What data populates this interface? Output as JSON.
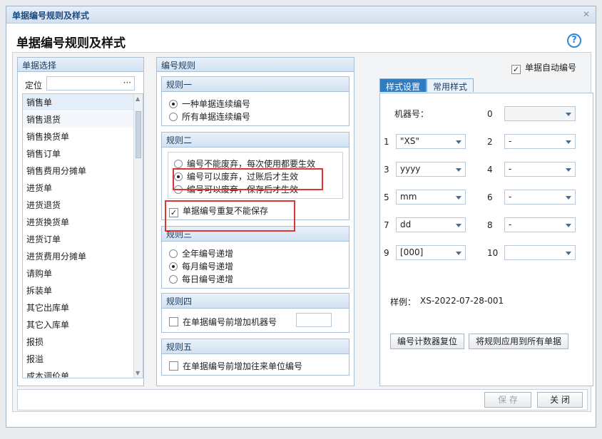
{
  "window": {
    "title": "单据编号规则及样式",
    "close": "✕"
  },
  "header": {
    "title": "单据编号规则及样式",
    "help": "?"
  },
  "auto_number": {
    "label": "单据自动编号",
    "checked": true
  },
  "left": {
    "title": "单据选择",
    "locate_label": "定位",
    "locate_btn": "···",
    "items": [
      "销售单",
      "销售退货",
      "销售换货单",
      "销售订单",
      "销售费用分摊单",
      "进货单",
      "进货退货",
      "进货换货单",
      "进货订单",
      "进货费用分摊单",
      "请购单",
      "拆装单",
      "其它出库单",
      "其它入库单",
      "报损",
      "报溢",
      "成本调价单"
    ]
  },
  "rules": {
    "title": "编号规则",
    "rule1": {
      "title": "规则一",
      "opt1": "一种单据连续编号",
      "opt2": "所有单据连续编号"
    },
    "rule2": {
      "title": "规则二",
      "opt1": "编号不能废弃，每次使用都要生效",
      "opt2": "编号可以废弃，过账后才生效",
      "opt3": "编号可以废弃，保存后才生效",
      "dup": "单据编号重复不能保存"
    },
    "rule3": {
      "title": "规则三",
      "opt1": "全年编号递增",
      "opt2": "每月编号递增",
      "opt3": "每日编号递增"
    },
    "rule4": {
      "title": "规则四",
      "opt1": "在单据编号前增加机器号"
    },
    "rule5": {
      "title": "规则五",
      "opt1": "在单据编号前增加往来单位编号"
    }
  },
  "style": {
    "tab_active": "样式设置",
    "tab_inactive": "常用样式",
    "machine_label": "机器号：",
    "idx0": "0",
    "idx1": "1",
    "idx2": "2",
    "idx3": "3",
    "idx4": "4",
    "idx5": "5",
    "idx6": "6",
    "idx7": "7",
    "idx8": "8",
    "idx9": "9",
    "idx10": "10",
    "v1": "\"XS\"",
    "v2": "-",
    "v3": "yyyy",
    "v4": "-",
    "v5": "mm",
    "v6": "-",
    "v7": "dd",
    "v8": "-",
    "v9": "[000]",
    "v10": "",
    "sample_label": "样例：",
    "sample_value": "XS-2022-07-28-001",
    "btn_reset": "编号计数器复位",
    "btn_apply": "将规则应用到所有单据"
  },
  "footer": {
    "save": "保 存",
    "close": "关 闭"
  },
  "colors": {
    "accent": "#2f7bc4",
    "highlight_box": "#e0352e"
  }
}
